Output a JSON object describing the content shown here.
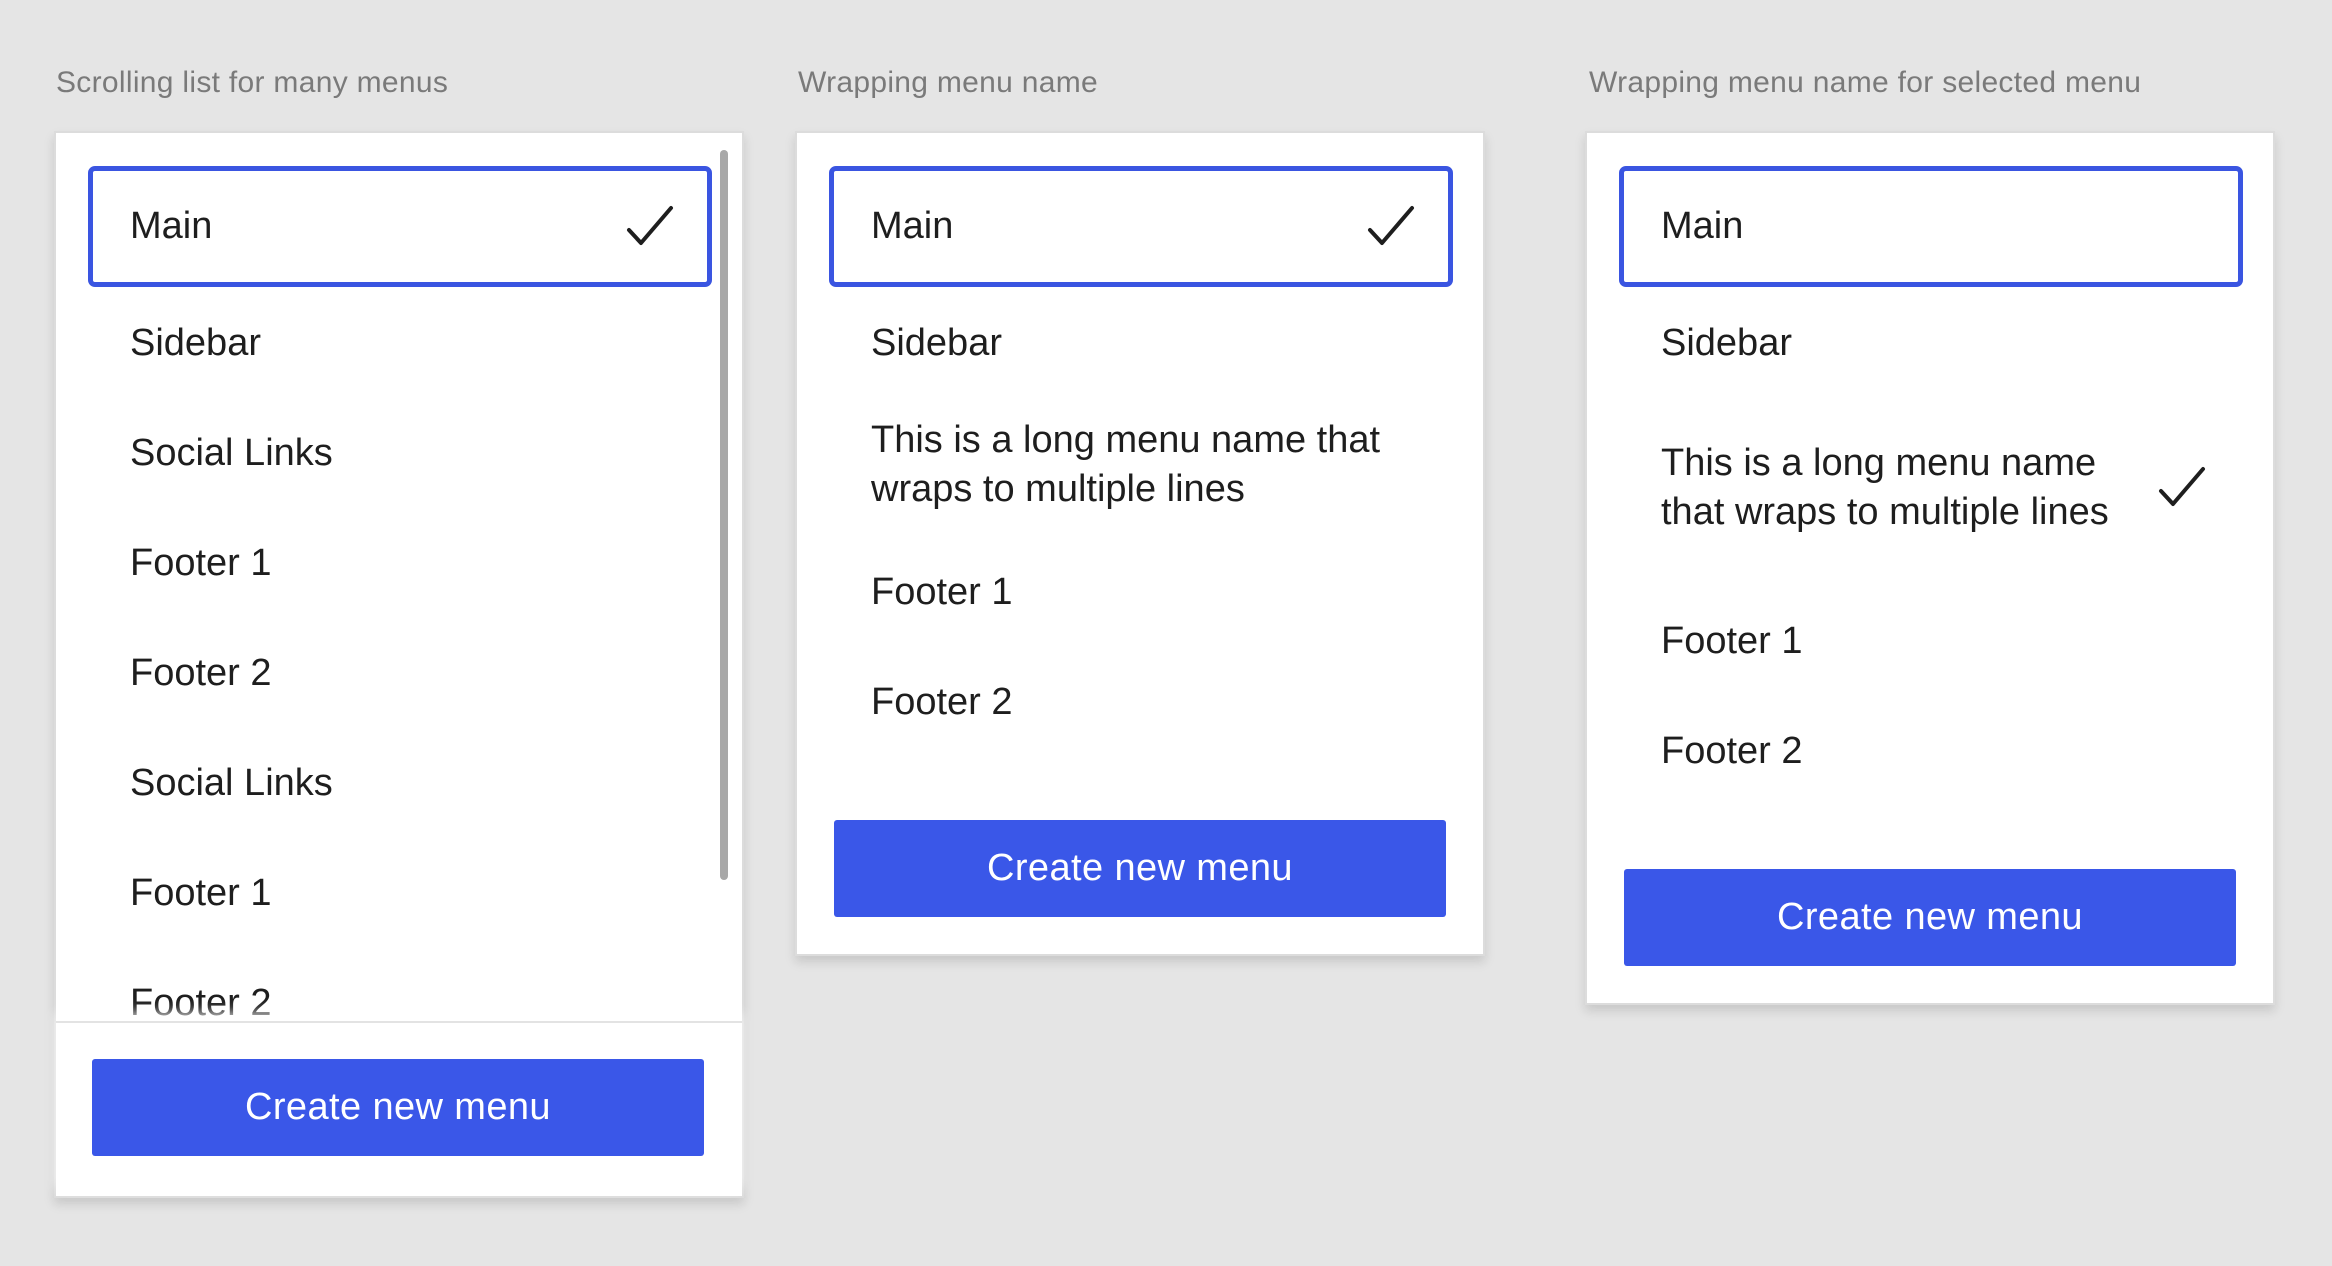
{
  "columns": [
    {
      "title": "Scrolling list for many menus",
      "items": [
        "Main",
        "Sidebar",
        "Social Links",
        "Footer 1",
        "Footer 2",
        "Social Links",
        "Footer 1",
        "Footer 2"
      ],
      "button_label": "Create new menu"
    },
    {
      "title": "Wrapping menu name",
      "items": [
        "Main",
        "Sidebar",
        "This is a long menu name that wraps to multiple lines",
        "Footer 1",
        "Footer 2"
      ],
      "button_label": "Create new menu"
    },
    {
      "title": "Wrapping menu name for selected menu",
      "items": [
        "Main",
        "Sidebar",
        "This is a long menu name that wraps to multiple lines",
        "Footer 1",
        "Footer 2"
      ],
      "button_label": "Create new menu"
    }
  ],
  "icons": {
    "check": "checkmark-icon"
  },
  "colors": {
    "accent": "#3a55e1",
    "button": "#3a57e8",
    "background": "#e5e5e5"
  }
}
